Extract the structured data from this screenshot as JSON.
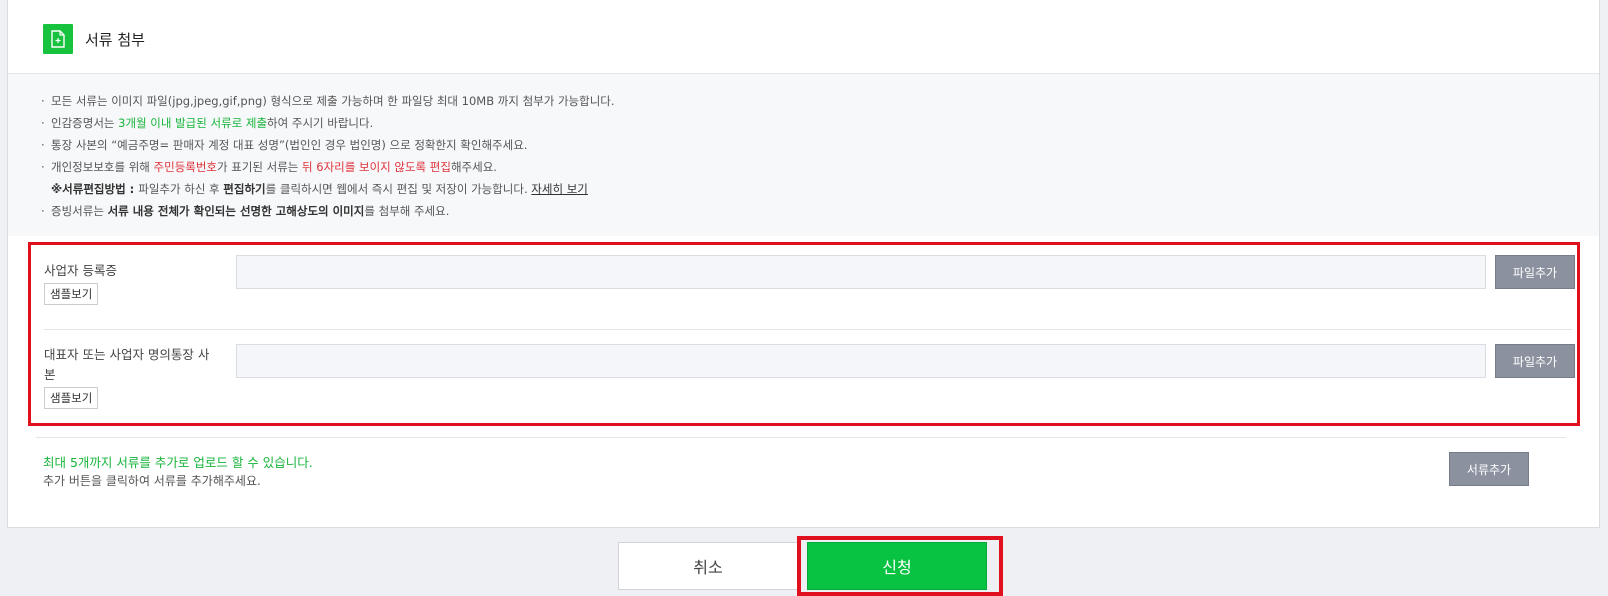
{
  "section": {
    "title": "서류 첨부",
    "icon": "document-add-icon"
  },
  "notice": {
    "line1": "모든 서류는 이미지 파일(jpg,jpeg,gif,png) 형식으로 제출 가능하며 한 파일당 최대 10MB 까지 첨부가 가능합니다.",
    "line2_a": "인감증명서는 ",
    "line2_b": "3개월 이내 발급된 서류로 제출",
    "line2_c": "하여 주시기 바랍니다.",
    "line3": "통장 사본의 “예금주명= 판매자 계정 대표 성명”(법인인 경우 법인명) 으로 정확한지 확인해주세요.",
    "line4_a": "개인정보보호를 위해 ",
    "line4_b": "주민등록번호",
    "line4_c": "가 표기된 서류는 ",
    "line4_d": "뒤 6자리를 보이지 않도록 편집",
    "line4_e": "해주세요.",
    "line5_a": "※서류편집방법 : ",
    "line5_b": "파일추가 하신 후 ",
    "line5_c": "편집하기",
    "line5_d": "를 클릭하시면 웹에서 즉시 편집 및 저장이 가능합니다. ",
    "line5_link": "자세히 보기",
    "line6_a": "증빙서류는 ",
    "line6_b": "서류 내용 전체가 확인되는 선명한 고해상도의 이미지",
    "line6_c": "를 첨부해 주세요."
  },
  "uploads": [
    {
      "label": "사업자 등록증",
      "sample_label": "샘플보기",
      "file_value": "",
      "add_label": "파일추가"
    },
    {
      "label": "대표자 또는 사업자 명의통장 사본",
      "sample_label": "샘플보기",
      "file_value": "",
      "add_label": "파일추가"
    }
  ],
  "add_doc": {
    "note1": "최대 5개까지 서류를 추가로 업로드 할 수 있습니다.",
    "note2": "추가 버튼을 클릭하여 서류를 추가해주세요.",
    "button_label": "서류추가"
  },
  "actions": {
    "cancel_label": "취소",
    "submit_label": "신청"
  },
  "colors": {
    "accent_green": "#08c241",
    "highlight_red": "#e0101e",
    "button_gray": "#8b919e"
  }
}
